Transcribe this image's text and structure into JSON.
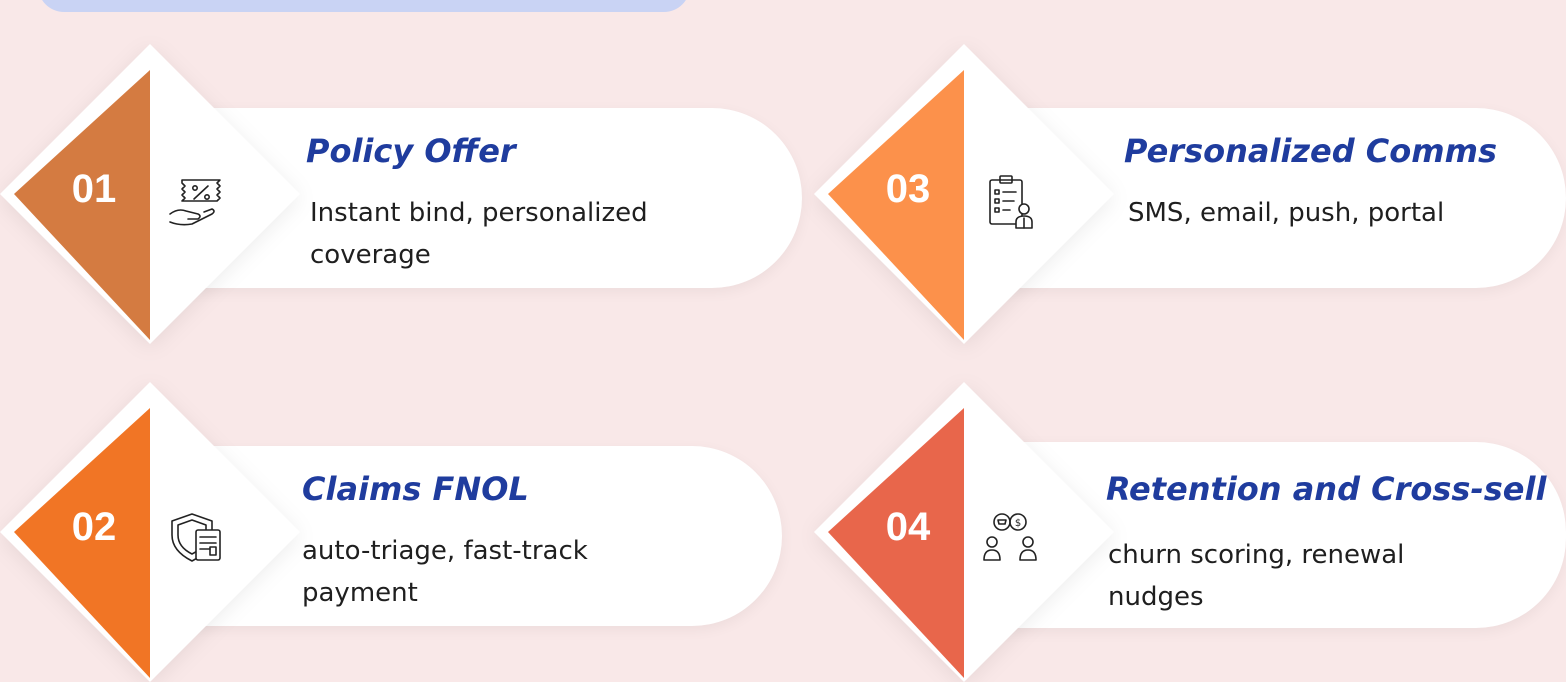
{
  "steps": [
    {
      "number": "01",
      "title": "Policy Offer",
      "description": "Instant bind, personalized coverage",
      "color": "#d47b41",
      "icon": "discount-hand-icon"
    },
    {
      "number": "02",
      "title": "Claims FNOL",
      "description": "auto-triage, fast-track payment",
      "color": "#f17525",
      "icon": "shield-document-icon"
    },
    {
      "number": "03",
      "title": "Personalized Comms",
      "description": "SMS, email, push, portal",
      "color": "#fc914b",
      "icon": "clipboard-person-icon"
    },
    {
      "number": "04",
      "title": "Retention and Cross-sell",
      "description": "churn scoring, renewal nudges",
      "color": "#e8664b",
      "icon": "customers-chat-icon"
    }
  ]
}
